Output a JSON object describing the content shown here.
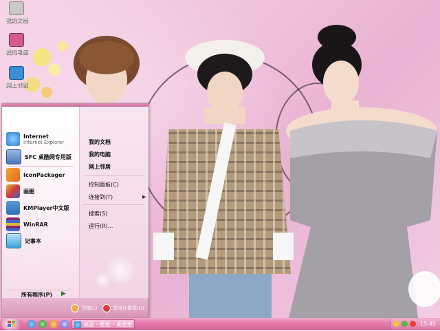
{
  "desktop_icons": [
    {
      "label": "我的文档",
      "icon": "my-documents-icon",
      "color": "#c9c9c9"
    },
    {
      "label": "我的电脑",
      "icon": "my-computer-icon",
      "color": "#d25b8b"
    },
    {
      "label": "网上邻居",
      "icon": "network-places-icon",
      "color": "#3a8fd6"
    }
  ],
  "start_menu": {
    "pinned": [
      {
        "title": "Internet",
        "subtitle": "Internet Explorer",
        "icon": "internet-explorer-icon",
        "color": "#2b7fd0"
      },
      {
        "title": "SFC 桌酷网专用版",
        "icon": "sfc-icon",
        "color": "#4a78b8"
      }
    ],
    "recent": [
      {
        "title": "IconPackager",
        "icon": "iconpackager-icon",
        "color": "#e06a1a"
      },
      {
        "title": "画图",
        "icon": "paint-icon",
        "color": "#e0b43a"
      },
      {
        "title": "KMPlayer中文版",
        "icon": "kmplayer-icon",
        "color": "#2a6fb8"
      },
      {
        "title": "WinRAR",
        "icon": "winrar-icon",
        "color": "#8a2a6a"
      },
      {
        "title": "记事本",
        "icon": "notepad-icon",
        "color": "#3aa0d8"
      }
    ],
    "all_programs": "所有程序(P)",
    "right": [
      {
        "label": "我的文档",
        "bold": true
      },
      {
        "label": "我的电脑",
        "bold": true
      },
      {
        "label": "网上邻居",
        "bold": true
      },
      {
        "label": "控制面板(C)",
        "bold": false
      },
      {
        "label": "连接到(T)",
        "bold": false,
        "arrow": "▶"
      },
      {
        "label": "搜索(S)",
        "bold": false
      },
      {
        "label": "运行(R)...",
        "bold": false
      }
    ],
    "logoff": "注销(L)",
    "shutdown": "关闭计算机(U)"
  },
  "taskbar": {
    "tasks": [
      {
        "label": "桌面 - 壁纸 - 桌酷壁...",
        "icon": "ie-task-icon",
        "color": "#2b7fd0"
      }
    ],
    "clock": "15:45",
    "colors": {
      "bar": "#e47aaa",
      "menu_bottom": "#d894b6"
    }
  }
}
